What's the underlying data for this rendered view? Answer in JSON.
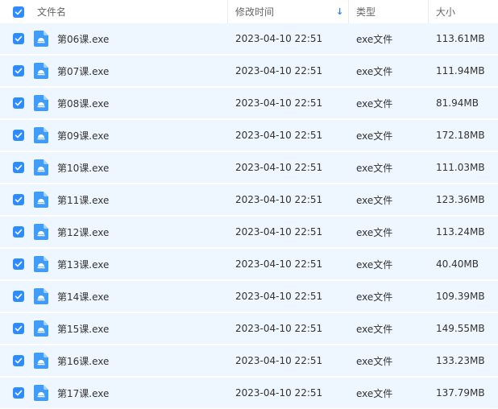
{
  "colors": {
    "accent": "#2f8cff",
    "row_selected_bg": "#eef6ff",
    "icon_blue": "#3f9cf8"
  },
  "header": {
    "name": "文件名",
    "mtime": "修改时间",
    "type": "类型",
    "size": "大小",
    "sort_indicator": "↓",
    "sort_icon": "arrow-down-icon"
  },
  "files": [
    {
      "name": "第06课.exe",
      "mtime": "2023-04-10 22:51",
      "type": "exe文件",
      "size": "113.61MB"
    },
    {
      "name": "第07课.exe",
      "mtime": "2023-04-10 22:51",
      "type": "exe文件",
      "size": "111.94MB"
    },
    {
      "name": "第08课.exe",
      "mtime": "2023-04-10 22:51",
      "type": "exe文件",
      "size": "81.94MB"
    },
    {
      "name": "第09课.exe",
      "mtime": "2023-04-10 22:51",
      "type": "exe文件",
      "size": "172.18MB"
    },
    {
      "name": "第10课.exe",
      "mtime": "2023-04-10 22:51",
      "type": "exe文件",
      "size": "111.03MB"
    },
    {
      "name": "第11课.exe",
      "mtime": "2023-04-10 22:51",
      "type": "exe文件",
      "size": "123.36MB"
    },
    {
      "name": "第12课.exe",
      "mtime": "2023-04-10 22:51",
      "type": "exe文件",
      "size": "113.24MB"
    },
    {
      "name": "第13课.exe",
      "mtime": "2023-04-10 22:51",
      "type": "exe文件",
      "size": "40.40MB"
    },
    {
      "name": "第14课.exe",
      "mtime": "2023-04-10 22:51",
      "type": "exe文件",
      "size": "109.39MB"
    },
    {
      "name": "第15课.exe",
      "mtime": "2023-04-10 22:51",
      "type": "exe文件",
      "size": "149.55MB"
    },
    {
      "name": "第16课.exe",
      "mtime": "2023-04-10 22:51",
      "type": "exe文件",
      "size": "133.23MB"
    },
    {
      "name": "第17课.exe",
      "mtime": "2023-04-10 22:51",
      "type": "exe文件",
      "size": "137.79MB"
    }
  ]
}
